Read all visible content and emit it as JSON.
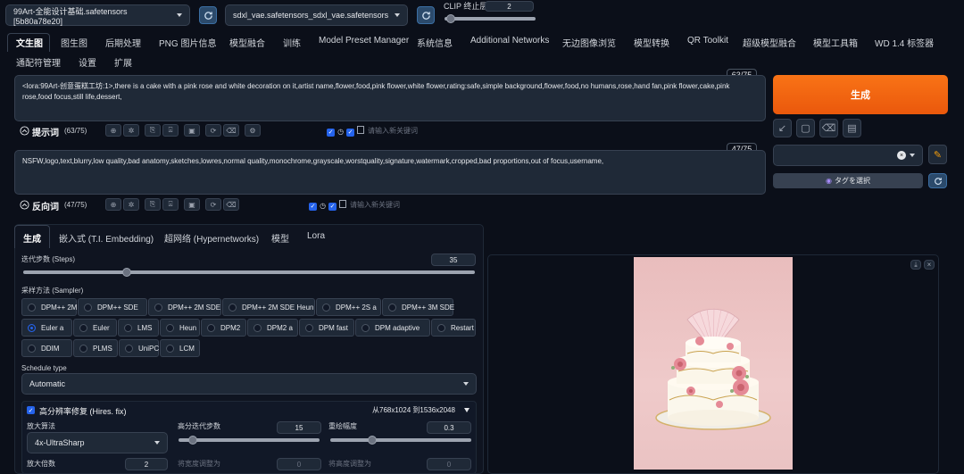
{
  "top": {
    "model_label": "",
    "model_value": "99Art-全能设计基础.safetensors [5b80a78e20]",
    "vae_label": "",
    "vae_value": "sdxl_vae.safetensors_sdxl_vae.safetensors",
    "clip_label": "CLIP 终止层数",
    "clip_value": "2"
  },
  "tabs_row1": [
    "文生图",
    "图生图",
    "后期处理",
    "PNG 图片信息",
    "模型融合",
    "训练",
    "Model Preset Manager",
    "系统信息",
    "Additional Networks",
    "无边图像浏览",
    "模型转换",
    "QR Toolkit",
    "超级模型融合",
    "模型工具箱",
    "WD 1.4 标签器"
  ],
  "tabs_row2": [
    "通配符管理",
    "设置",
    "扩展"
  ],
  "prompt": {
    "text": "<lora:99Art-创意蛋糕工坊:1>,there is a cake with a pink rose and white decoration on it,artist name,flower,food,pink flower,white flower,rating:safe,simple background,flower,food,no humans,rose,hand fan,pink flower,cake,pink rose,food focus,still life,dessert,",
    "counter": "63/75",
    "label": "提示词",
    "count": "(63/75)",
    "keyword_placeholder": "请输入新关键词"
  },
  "negative": {
    "text": "NSFW,logo,text,blurry,low quality,bad anatomy,sketches,lowres,normal quality,monochrome,grayscale,worstquality,signature,watermark,cropped,bad proportions,out of focus,username,",
    "counter": "47/75",
    "label": "反向词",
    "count": "(47/75)",
    "keyword_placeholder": "请输入新关键词"
  },
  "generate_label": "生成",
  "tag_select_label": "タグを選択",
  "subtabs": [
    "生成",
    "嵌入式 (T.I. Embedding)",
    "超网络 (Hypernetworks)",
    "模型",
    "Lora"
  ],
  "steps": {
    "label": "迭代步数 (Steps)",
    "value": "35",
    "fraction": 0.23
  },
  "sampler": {
    "label": "采样方法 (Sampler)",
    "row1": [
      "DPM++ 2M",
      "DPM++ SDE",
      "DPM++ 2M SDE",
      "DPM++ 2M SDE Heun",
      "DPM++ 2S a",
      "DPM++ 3M SDE"
    ],
    "row2": [
      "Euler a",
      "Euler",
      "LMS",
      "Heun",
      "DPM2",
      "DPM2 a",
      "DPM fast",
      "DPM adaptive",
      "Restart"
    ],
    "row3": [
      "DDIM",
      "PLMS",
      "UniPC",
      "LCM"
    ],
    "selected": "Euler a"
  },
  "schedule": {
    "label": "Schedule type",
    "value": "Automatic"
  },
  "hires": {
    "label": "高分辨率修复 (Hires. fix)",
    "resolution": "从768x1024 到1536x2048",
    "upscaler_label": "放大算法",
    "upscaler_value": "4x-UltraSharp",
    "steps_label": "高分迭代步数",
    "steps_value": "15",
    "steps_fraction": 0.1,
    "denoise_label": "重绘幅度",
    "denoise_value": "0.3",
    "denoise_fraction": 0.3,
    "scale_label": "放大倍数",
    "scale_value": "2",
    "width_label": "将宽度调整为",
    "width_value": "0",
    "height_label": "将高度调整为",
    "height_value": "0"
  },
  "colors": {
    "accent": "#f97316",
    "selected": "#2563eb",
    "bg": "#0b0f19"
  }
}
